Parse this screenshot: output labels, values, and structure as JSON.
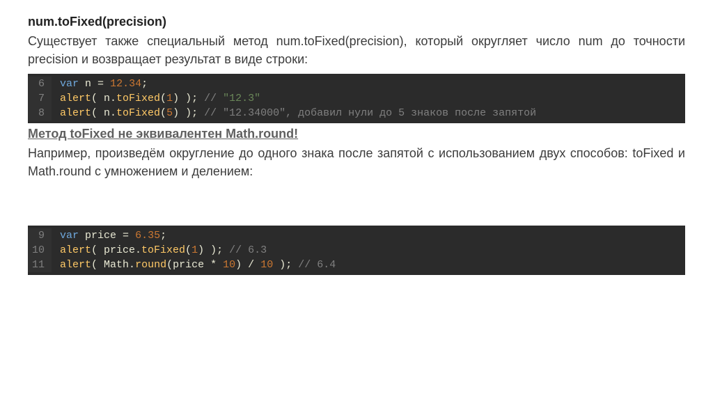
{
  "section1": {
    "heading": "num.toFixed(precision)",
    "paragraph": "Существует также специальный метод num.toFixed(precision), который округляет число num до точности precision и возвращает результат в виде строки:"
  },
  "code1": {
    "lines": [
      {
        "n": "6",
        "tokens": [
          {
            "t": "var",
            "c": "kw"
          },
          {
            "t": " n ",
            "c": "id"
          },
          {
            "t": "=",
            "c": "op"
          },
          {
            "t": " ",
            "c": "op"
          },
          {
            "t": "12.34",
            "c": "num"
          },
          {
            "t": ";",
            "c": "op"
          }
        ]
      },
      {
        "n": "7",
        "tokens": [
          {
            "t": "alert",
            "c": "fn"
          },
          {
            "t": "( n.",
            "c": "op"
          },
          {
            "t": "toFixed",
            "c": "fn"
          },
          {
            "t": "(",
            "c": "op"
          },
          {
            "t": "1",
            "c": "num"
          },
          {
            "t": ") );",
            "c": "op"
          },
          {
            "t": " // ",
            "c": "cmt"
          },
          {
            "t": "\"12.3\"",
            "c": "str"
          }
        ]
      },
      {
        "n": "8",
        "tokens": [
          {
            "t": "alert",
            "c": "fn"
          },
          {
            "t": "( n.",
            "c": "op"
          },
          {
            "t": "toFixed",
            "c": "fn"
          },
          {
            "t": "(",
            "c": "op"
          },
          {
            "t": "5",
            "c": "num"
          },
          {
            "t": ") );",
            "c": "op"
          },
          {
            "t": " // ",
            "c": "cmt"
          },
          {
            "t": "\"12.34000\", добавил нули до 5 знаков после запятой",
            "c": "cmt"
          }
        ]
      }
    ]
  },
  "section2": {
    "heading": "Метод toFixed не эквивалентен Math.round!",
    "paragraph": "Например, произведём округление до одного знака после запятой с использованием двух способов: toFixed и Math.round с умножением и делением:"
  },
  "code2": {
    "lines": [
      {
        "n": "9",
        "tokens": [
          {
            "t": "var",
            "c": "kw"
          },
          {
            "t": " price ",
            "c": "id"
          },
          {
            "t": "=",
            "c": "op"
          },
          {
            "t": " ",
            "c": "op"
          },
          {
            "t": "6.35",
            "c": "num"
          },
          {
            "t": ";",
            "c": "op"
          }
        ]
      },
      {
        "n": "10",
        "tokens": [
          {
            "t": "alert",
            "c": "fn"
          },
          {
            "t": "( price.",
            "c": "op"
          },
          {
            "t": "toFixed",
            "c": "fn"
          },
          {
            "t": "(",
            "c": "op"
          },
          {
            "t": "1",
            "c": "num"
          },
          {
            "t": ") );",
            "c": "op"
          },
          {
            "t": " // 6.3",
            "c": "cmt"
          }
        ]
      },
      {
        "n": "11",
        "tokens": [
          {
            "t": "alert",
            "c": "fn"
          },
          {
            "t": "( ",
            "c": "op"
          },
          {
            "t": "Math",
            "c": "id"
          },
          {
            "t": ".",
            "c": "op"
          },
          {
            "t": "round",
            "c": "fn"
          },
          {
            "t": "(price ",
            "c": "op"
          },
          {
            "t": "*",
            "c": "op"
          },
          {
            "t": " ",
            "c": "op"
          },
          {
            "t": "10",
            "c": "num"
          },
          {
            "t": ") ",
            "c": "op"
          },
          {
            "t": "/",
            "c": "op"
          },
          {
            "t": " ",
            "c": "op"
          },
          {
            "t": "10",
            "c": "num"
          },
          {
            "t": " );",
            "c": "op"
          },
          {
            "t": " // 6.4",
            "c": "cmt"
          }
        ]
      }
    ]
  }
}
